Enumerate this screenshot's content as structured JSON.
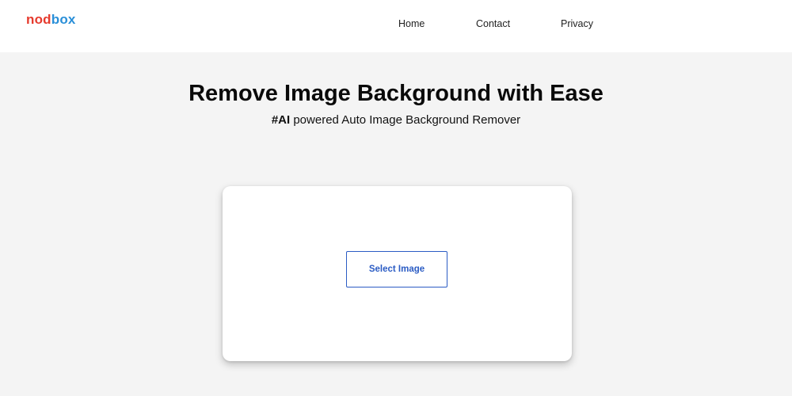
{
  "header": {
    "logo": {
      "part_a": "nod",
      "part_b": "box",
      "color_a": "#e63b2e",
      "color_b": "#2a8fd8"
    },
    "nav": {
      "home": "Home",
      "contact": "Contact",
      "privacy": "Privacy"
    }
  },
  "hero": {
    "title": "Remove Image Background with Ease",
    "subtitle_tag": "#AI",
    "subtitle_rest": " powered Auto Image Background Remover"
  },
  "upload": {
    "button_label": "Select Image",
    "accent_color": "#2b5cc4"
  }
}
